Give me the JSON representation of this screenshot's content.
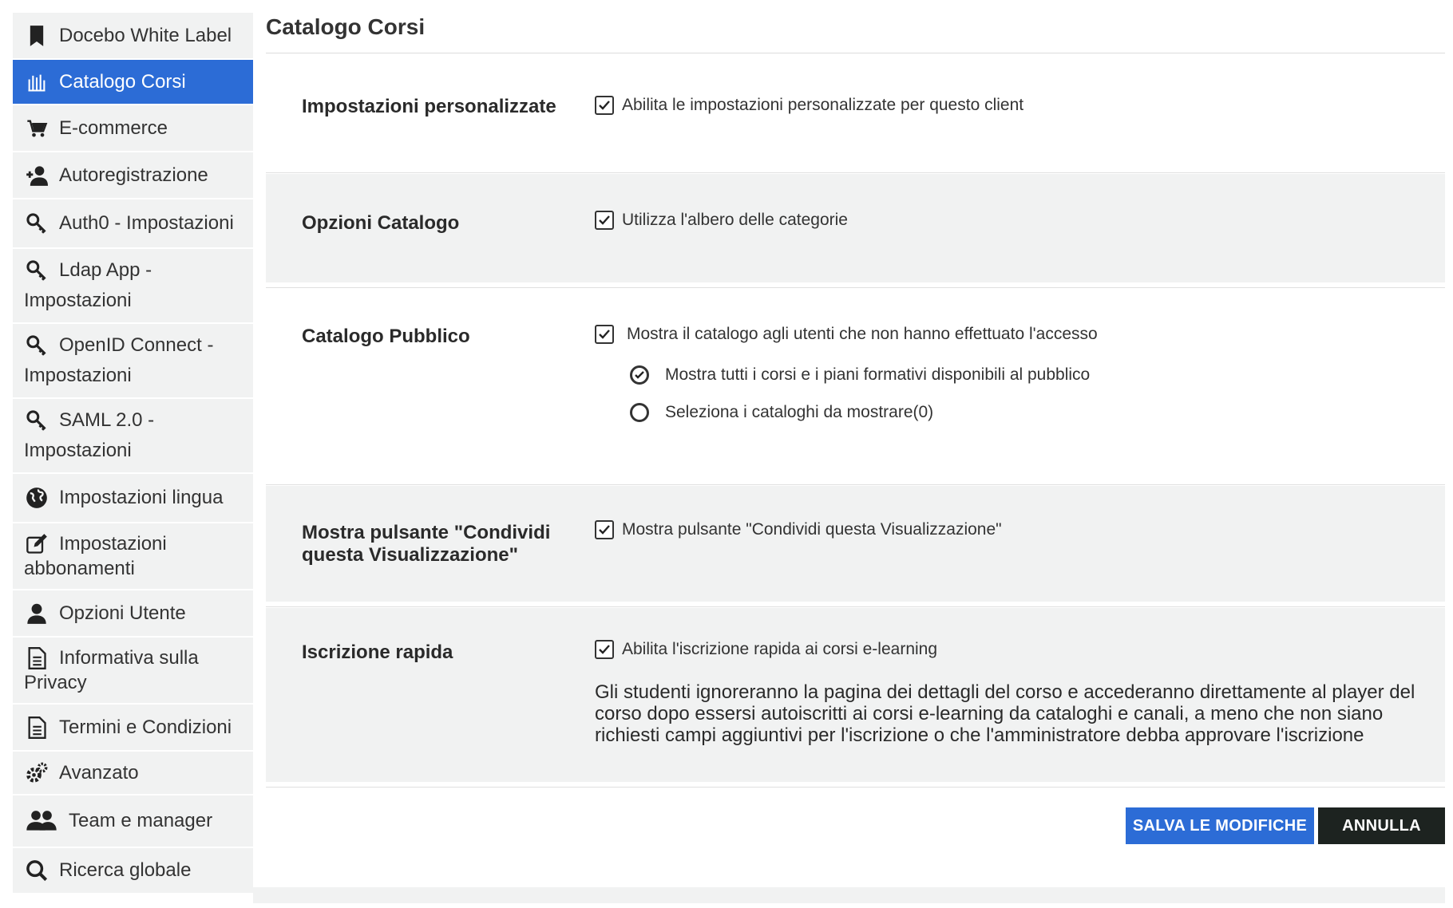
{
  "sidebar": {
    "items": [
      {
        "label": "Docebo White Label",
        "icon": "bookmark-icon"
      },
      {
        "label": "Catalogo Corsi",
        "icon": "catalog-icon",
        "active": true
      },
      {
        "label": "E-commerce",
        "icon": "cart-icon"
      },
      {
        "label": "Autoregistrazione",
        "icon": "add-user-icon"
      },
      {
        "label": "Auth0 - Impostazioni",
        "icon": "key-icon"
      },
      {
        "label_line1": "Ldap App -",
        "label_line2": "Impostazioni",
        "icon": "key-icon"
      },
      {
        "label_line1": "OpenID Connect -",
        "label_line2": "Impostazioni",
        "icon": "key-icon"
      },
      {
        "label_line1": "SAML 2.0 -",
        "label_line2": "Impostazioni",
        "icon": "key-icon"
      },
      {
        "label": "Impostazioni lingua",
        "icon": "globe-icon"
      },
      {
        "label_line1": "Impostazioni",
        "label_line2": "abbonamenti",
        "icon": "edit-icon"
      },
      {
        "label": "Opzioni Utente",
        "icon": "user-icon"
      },
      {
        "label_line1": "Informativa sulla",
        "label_line2": "Privacy",
        "icon": "document-icon"
      },
      {
        "label": "Termini e Condizioni",
        "icon": "document-icon"
      },
      {
        "label": "Avanzato",
        "icon": "gears-icon"
      },
      {
        "label": "Team e manager",
        "icon": "team-icon"
      },
      {
        "label": "Ricerca globale",
        "icon": "search-icon"
      }
    ]
  },
  "main": {
    "title": "Catalogo Corsi",
    "sections": {
      "custom": {
        "label": "Impostazioni personalizzate",
        "option": "Abilita le impostazioni personalizzate per questo client"
      },
      "catalog_options": {
        "label": "Opzioni Catalogo",
        "option": "Utilizza l'albero delle categorie"
      },
      "public_catalog": {
        "label": "Catalogo Pubblico",
        "option": "Mostra il catalogo agli utenti che non hanno effettuato l'accesso",
        "radio_all": "Mostra tutti i corsi e i piani formativi disponibili al pubblico",
        "radio_select": "Seleziona i cataloghi da mostrare(0)"
      },
      "share": {
        "label_line1": "Mostra pulsante \"Condividi",
        "label_line2": "questa Visualizzazione\"",
        "option": "Mostra pulsante \"Condividi questa Visualizzazione\""
      },
      "quick_enroll": {
        "label": "Iscrizione rapida",
        "option": "Abilita l'iscrizione rapida ai corsi e-learning",
        "description": "Gli studenti ignoreranno la pagina dei dettagli del corso e accederanno direttamente al player del corso dopo essersi autoiscritti ai corsi e-learning da cataloghi e canali, a meno che non siano richiesti campi aggiuntivi per l'iscrizione o che l'amministratore debba approvare l'iscrizione"
      }
    },
    "buttons": {
      "save": "SALVA LE MODIFICHE",
      "cancel": "ANNULLA"
    }
  },
  "colors": {
    "accent": "#2c6cd6",
    "dark_button": "#1d2320",
    "panel": "#f1f2f2"
  }
}
